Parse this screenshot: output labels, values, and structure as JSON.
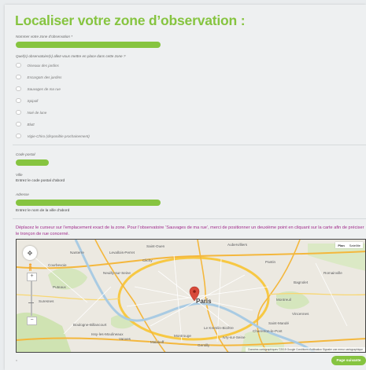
{
  "form": {
    "title": "Localiser votre zone d’observation :",
    "zone_name_label": "Nommer votre zone d’observation *",
    "zone_name_value": "",
    "observatory_question": "Quel(s) observatoire(s) allez-vous mettre en place dans cette zone ?",
    "observatories": [
      "Oiseaux des jardins",
      "Escargots des jardins",
      "Sauvages de ma rue",
      "Spipoll",
      "Noé de lune",
      "Blutt",
      "Vigie-Chiro (disponible prochainement)"
    ],
    "postal_code_label": "Code postal",
    "city_label": "Ville",
    "city_hint": "Entrez le code postal d’abord",
    "address_label": "Adresse",
    "address_hint": "Entrez le nom de la ville d’abord",
    "notice": "Déplacez le curseur sur l’emplacement exact de la zone. Pour l’observatoire ‘Sauvages de ma rue’, merci de positionner un deuxième point en cliquant sur la carte afin de préciser le tronçon de rue concerné.",
    "required_note": "*",
    "next_button": "Page suivante"
  },
  "map": {
    "city_label": "Paris",
    "places": [
      "Nanterre",
      "Levallois-Perret",
      "Saint-Ouen",
      "Clichy",
      "Montreuil",
      "Boulogne-Billancourt",
      "Vanves",
      "Ivry-sur-Seine",
      "Vincennes",
      "Saint-Mandé",
      "Issy-les-Moulineaux",
      "Bagnolet",
      "Pantin",
      "Neuilly-sur-Seine",
      "Courbevoie",
      "Puteaux",
      "Suresnes",
      "Montrouge",
      "Gentilly",
      "Charenton-le-Pont",
      "Malakoff",
      "Romainville",
      "Aubervilliers",
      "Le Kremlin-Bicêtre"
    ],
    "type_options": [
      "Plan",
      "Satellite"
    ],
    "footer": "Données cartographiques ©2015 Google  Conditions d’utilisation  Signaler une erreur cartographique",
    "zoom_in": "+",
    "zoom_out": "−"
  },
  "colors": {
    "accent": "#86c440",
    "notice": "#a02a8a",
    "marker": "#d84a3a"
  },
  "icons": {
    "pan": "pan-control-icon",
    "pegman": "street-view-pegman-icon",
    "marker": "map-marker-icon"
  }
}
